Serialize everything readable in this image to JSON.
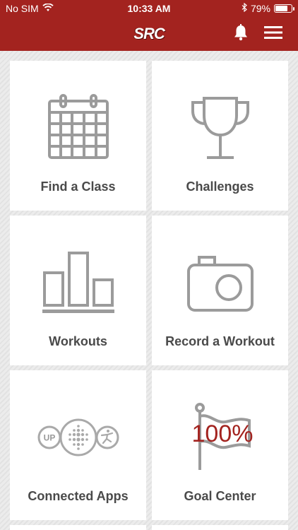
{
  "status_bar": {
    "carrier": "No SIM",
    "time": "10:33 AM",
    "battery": "79%",
    "battery_level": 0.79
  },
  "header": {
    "logo_text": "SRC"
  },
  "tiles": [
    {
      "label": "Find a Class",
      "icon": "calendar-icon"
    },
    {
      "label": "Challenges",
      "icon": "trophy-icon"
    },
    {
      "label": "Workouts",
      "icon": "bar-chart-icon"
    },
    {
      "label": "Record a Workout",
      "icon": "camera-icon"
    },
    {
      "label": "Connected Apps",
      "icon": "connected-apps-icon",
      "app_badge": "UP"
    },
    {
      "label": "Goal Center",
      "icon": "goal-flag-icon",
      "goal_text": "100%"
    }
  ],
  "colors": {
    "brand": "#a3231f",
    "icon_gray": "#9b9b9b",
    "label_text": "#4a4a4a"
  }
}
